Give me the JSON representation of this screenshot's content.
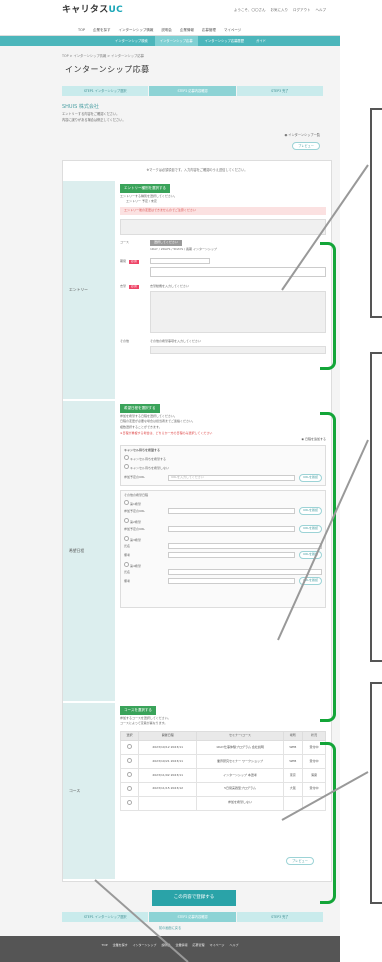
{
  "header": {
    "logo_text": "キャリタス",
    "logo_accent": "UC",
    "util_links": [
      "ようこそ、〇〇さん",
      "お気に入り",
      "ログアウト",
      "ヘルプ"
    ]
  },
  "global_nav": [
    "TOP",
    "企業を探す",
    "インターンシップ情報",
    "説明会",
    "企業情報",
    "応募管理",
    "マイページ"
  ],
  "sub_nav": [
    "インターンシップ検索",
    "インターンシップ応募",
    "インターンシップ応募履歴",
    "ガイド"
  ],
  "breadcrumb": "TOP > インターンシップ情報 > インターンシップ応募",
  "page_title": "インターンシップ応募",
  "steps": [
    "STEP1 インターンシップ選択",
    "STEP2 応募内容確認",
    "STEP3 完了"
  ],
  "company": {
    "name": "SHUIS 株式会社",
    "desc1": "エントリーする内容をご確認ください。",
    "desc2": "内容に誤りがある場合は修正してください。"
  },
  "mypage_link": "インターンシップ一覧",
  "print_button": "プレビュー",
  "top_note": "※マークは必須項目です。入力内容をご確認のうえ送信してください。",
  "sections": {
    "entry": {
      "label": "エントリー",
      "header": "エントリー種別を選択する",
      "desc": "エントリーする種別を選択してください。",
      "entry_choice": "エントリー 予定 / 未定",
      "pink_note": "エントリー後の変更はできませんのでご注意ください",
      "select_button": "選択してください",
      "course_label": "コース",
      "course_text": "1DAY / 2DAYS / 5DAYS / 長期 インターンシップ",
      "period_label": "期間",
      "motive_label": "志望",
      "motive_note": "志望動機を入力してください",
      "other_label": "その他",
      "other_note": "その他の希望事項を入力してください"
    },
    "schedule": {
      "label": "希望日程",
      "header": "希望日程を選択する",
      "desc1": "参加を希望する日程を選択してください。",
      "desc2": "日程の変更が必要な場合は担当者までご連絡ください。",
      "desc3": "複数選択することができます。",
      "red_note": "※日程が重複する場合は、どちらか一方の日程のみ選択してください",
      "more_link": "日程を追加する",
      "sub_header": "キャンセル待ちを希望する",
      "opt1": "キャンセル待ちを希望する",
      "opt2": "キャンセル待ちを希望しない",
      "url_label": "参加予定のURL",
      "url_placeholder": "URLを入力してください",
      "url_button": "URLを確認",
      "list_title": "その他の希望日程",
      "items": [
        "第1希望",
        "第2希望",
        "第3希望",
        "第4希望"
      ],
      "name_label": "氏名",
      "memo_label": "備考"
    },
    "course": {
      "label": "コース",
      "header": "コースを選択する",
      "desc1": "参加するコースを選択してください。",
      "desc2": "コースによって定員が異なります。",
      "cols": [
        "選択",
        "開催日程",
        "セミナー/コース",
        "場所",
        "状況"
      ],
      "rows": [
        {
          "date": "2023/10/12\n2023/11",
          "course": "1DAY仕事体験プログラム 会社説明",
          "place": "WEB",
          "status": "受付中"
        },
        {
          "date": "2023/10/21\n2023/11",
          "course": "業界研究セミナー ワークショップ",
          "place": "WEB",
          "status": "受付中"
        },
        {
          "date": "2023/11/02\n2023/11",
          "course": "インターンシップ 本選考",
          "place": "東京",
          "status": "満席"
        },
        {
          "date": "2023/11/15\n2023/12",
          "course": "5日間実践型プログラム",
          "place": "大阪",
          "status": "受付中"
        },
        {
          "date": "",
          "course": "参加を希望しない",
          "place": "",
          "status": ""
        }
      ],
      "link": "プレビュー"
    }
  },
  "submit_label": "この内容で登録する",
  "bottom_link": "前の画面に戻る",
  "footer_links": [
    "TOP",
    "企業を探す",
    "インターンシップ",
    "説明会",
    "企業情報",
    "応募管理",
    "マイページ",
    "ヘルプ"
  ],
  "colors": {
    "accent": "#2aa3a8",
    "green": "#13a538",
    "pink": "#fbe1e1"
  }
}
